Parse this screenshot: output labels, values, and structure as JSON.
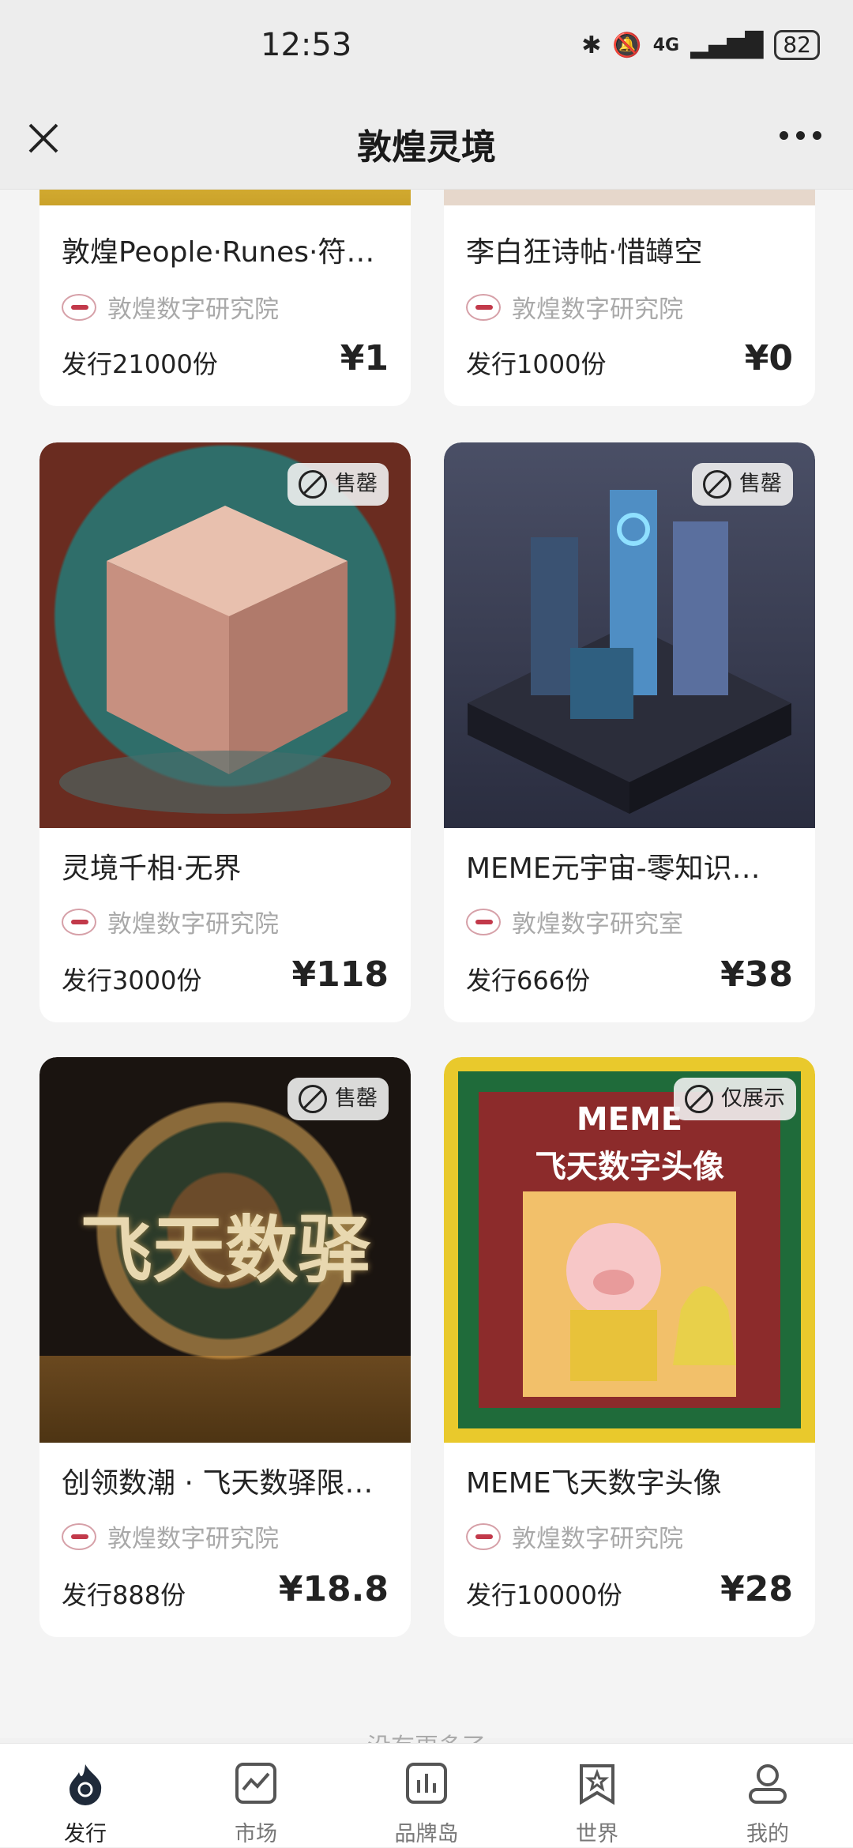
{
  "status": {
    "time": "12:53",
    "battery": "82",
    "network": "4G"
  },
  "titlebar": {
    "title": "敦煌灵境"
  },
  "cards": [
    {
      "name": "敦煌People·Runes·符…",
      "publisher": "敦煌数字研究院",
      "issue": "发行21000份",
      "price": "¥1",
      "badge": ""
    },
    {
      "name": "李白狂诗帖·惜罇空",
      "publisher": "敦煌数字研究院",
      "issue": "发行1000份",
      "price": "¥0",
      "badge": ""
    },
    {
      "name": "灵境千相·无界",
      "publisher": "敦煌数字研究院",
      "issue": "发行3000份",
      "price": "¥118",
      "badge": "售罄"
    },
    {
      "name": "MEME元宇宙-零知识…",
      "publisher": "敦煌数字研究室",
      "issue": "发行666份",
      "price": "¥38",
      "badge": "售罄"
    },
    {
      "name": "创领数潮 · 飞天数驿限…",
      "publisher": "敦煌数字研究院",
      "issue": "发行888份",
      "price": "¥18.8",
      "badge": "售罄"
    },
    {
      "name": "MEME飞天数字头像",
      "publisher": "敦煌数字研究院",
      "issue": "发行10000份",
      "price": "¥28",
      "badge": "仅展示"
    }
  ],
  "images": {
    "card3": {
      "text": ""
    },
    "card5": {
      "text": "飞天数驿"
    },
    "card6": {
      "line1": "MEME",
      "line2": "飞天数字头像"
    }
  },
  "footer": {
    "end_text": "没有更多了"
  },
  "tabs": [
    {
      "label": "发行",
      "icon": "flame-icon"
    },
    {
      "label": "市场",
      "icon": "chart-icon"
    },
    {
      "label": "品牌岛",
      "icon": "bar-chart-icon"
    },
    {
      "label": "世界",
      "icon": "bookmark-star-icon"
    },
    {
      "label": "我的",
      "icon": "user-icon"
    }
  ],
  "colors": {
    "active_tab": "#1f2a3a",
    "accent_badge_bg": "#f0f0f0"
  }
}
